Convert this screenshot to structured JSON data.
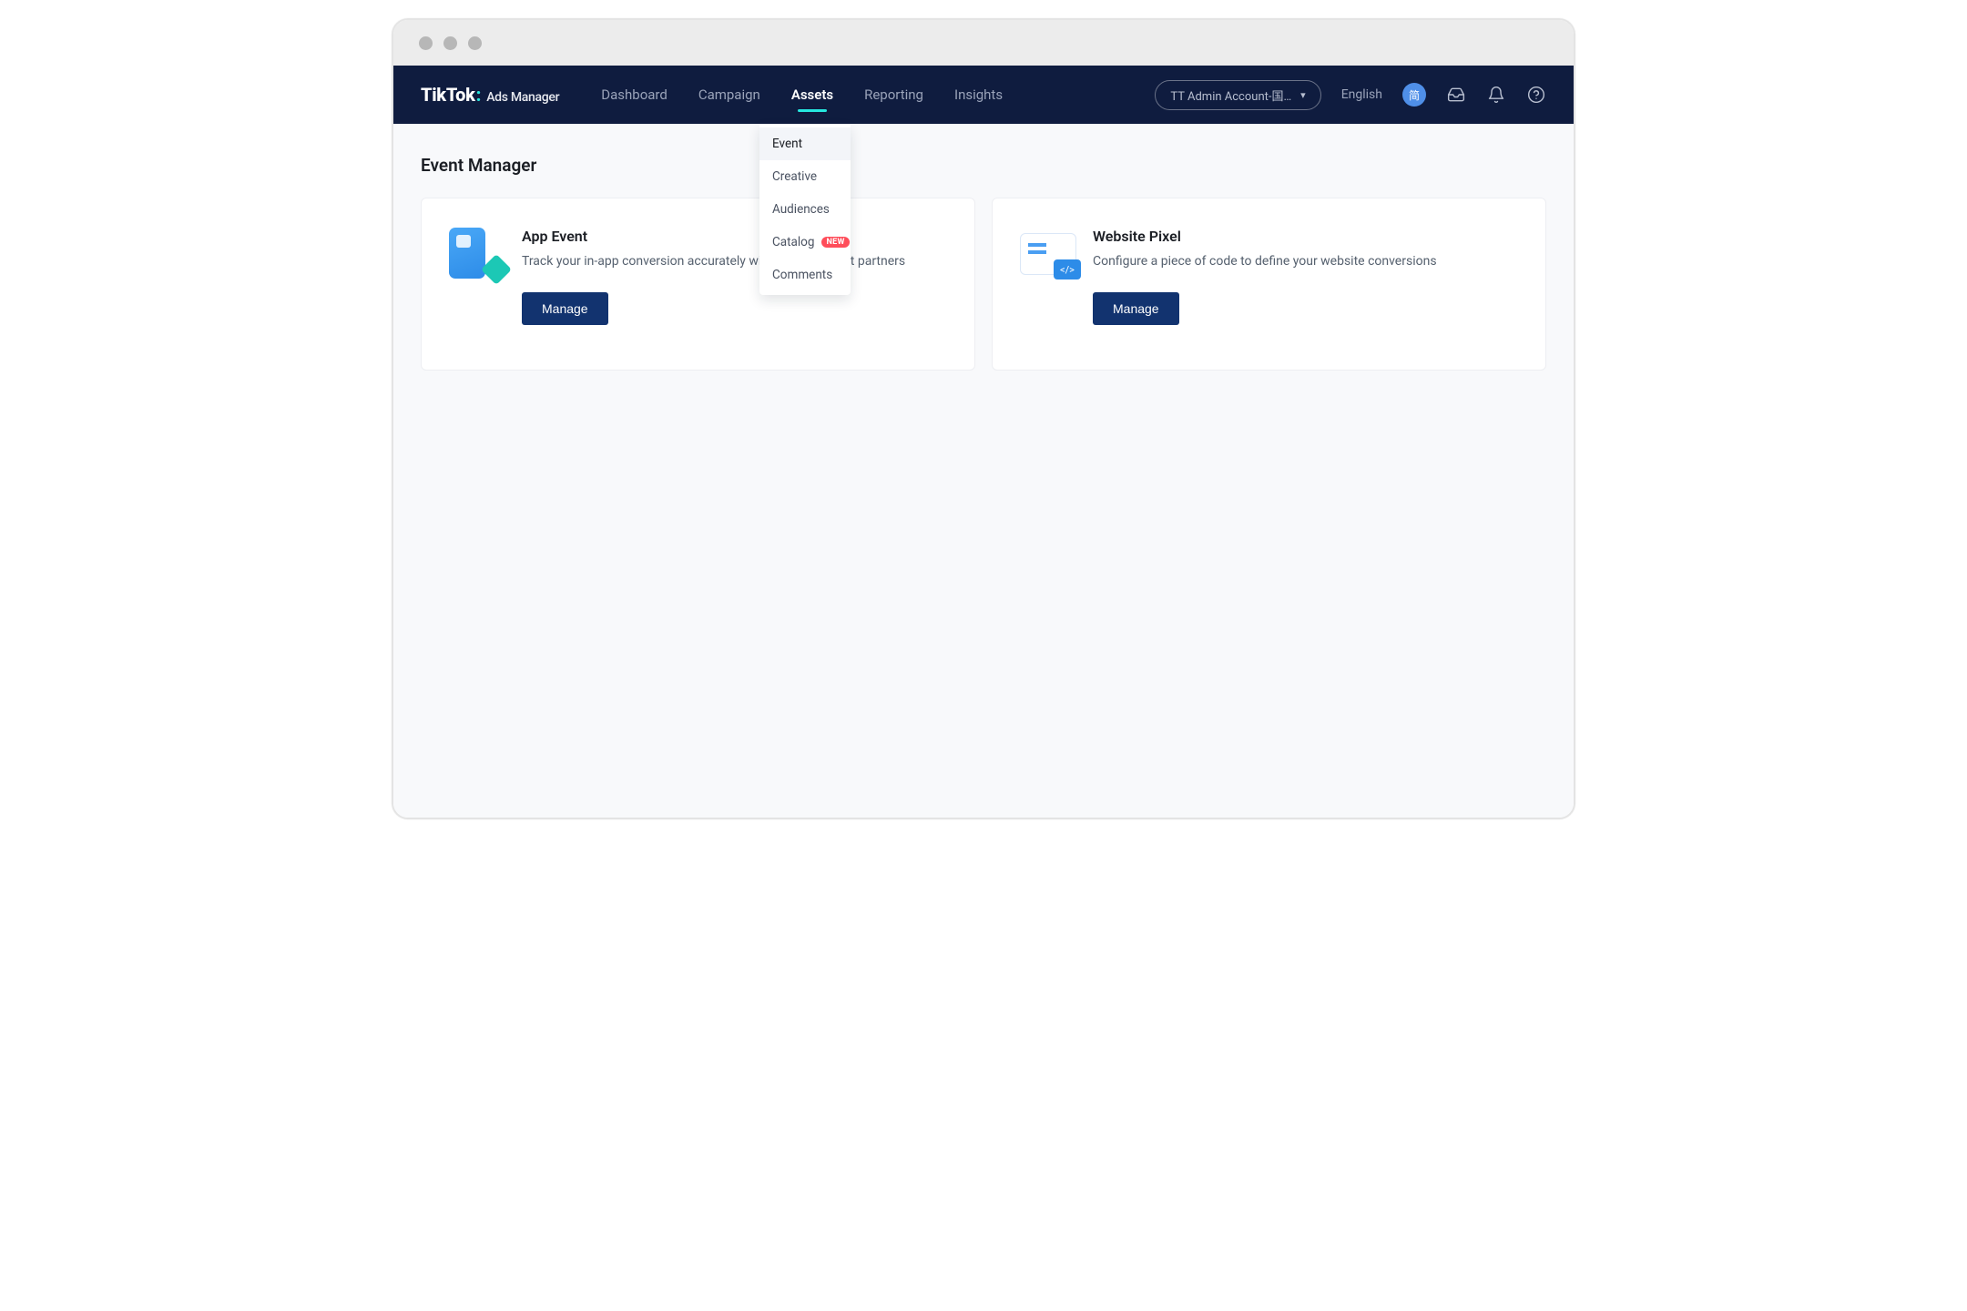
{
  "logo": {
    "brand": "TikTok",
    "product": "Ads Manager"
  },
  "nav": {
    "items": [
      {
        "label": "Dashboard",
        "active": false
      },
      {
        "label": "Campaign",
        "active": false
      },
      {
        "label": "Assets",
        "active": true
      },
      {
        "label": "Reporting",
        "active": false
      },
      {
        "label": "Insights",
        "active": false
      }
    ]
  },
  "header": {
    "account_label": "TT Admin Account-国…",
    "language": "English",
    "avatar_text": "简"
  },
  "dropdown": {
    "items": [
      {
        "label": "Event",
        "highlight": true
      },
      {
        "label": "Creative"
      },
      {
        "label": "Audiences"
      },
      {
        "label": "Catalog",
        "badge": "NEW"
      },
      {
        "label": "Comments"
      }
    ]
  },
  "page": {
    "title": "Event Manager",
    "cards": [
      {
        "title": "App Event",
        "desc": "Track your in-app conversion accurately with measurement partners",
        "button": "Manage"
      },
      {
        "title": "Website Pixel",
        "desc": "Configure a piece of code to define your website conversions",
        "button": "Manage"
      }
    ]
  }
}
